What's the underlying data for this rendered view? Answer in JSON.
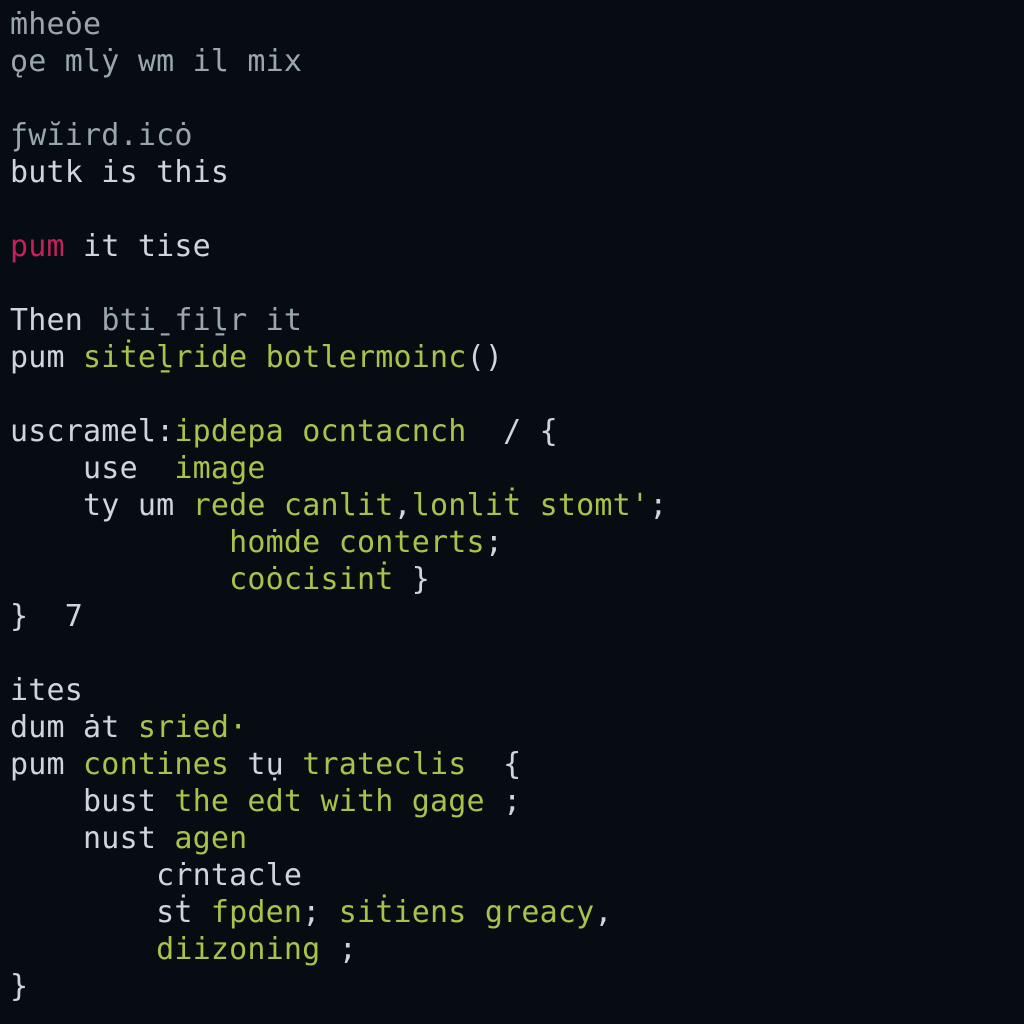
{
  "code": {
    "lines": [
      {
        "indent": 0,
        "tokens": [
          {
            "t": "ṁheȯe",
            "c": "dim"
          }
        ]
      },
      {
        "indent": 0,
        "tokens": [
          {
            "t": "ǫe mlẏ wm il mix",
            "c": "dim"
          }
        ]
      },
      {
        "indent": 0,
        "tokens": []
      },
      {
        "indent": 0,
        "tokens": [
          {
            "t": "ƒwĭird.icȯ",
            "c": "dim"
          }
        ]
      },
      {
        "indent": 0,
        "tokens": [
          {
            "t": "butk is this",
            "c": "plain"
          }
        ]
      },
      {
        "indent": 0,
        "tokens": []
      },
      {
        "indent": 0,
        "tokens": [
          {
            "t": "pum",
            "c": "kw"
          },
          {
            "t": " it tise",
            "c": "plain"
          }
        ]
      },
      {
        "indent": 0,
        "tokens": []
      },
      {
        "indent": 0,
        "tokens": [
          {
            "t": "Then ",
            "c": "plain"
          },
          {
            "t": "ḃtiˍfiḻr it",
            "c": "dim"
          }
        ]
      },
      {
        "indent": 0,
        "tokens": [
          {
            "t": "pum ",
            "c": "plain"
          },
          {
            "t": "siṫeḻride",
            "c": "fn"
          },
          {
            "t": " ",
            "c": "plain"
          },
          {
            "t": "botlermoinc",
            "c": "fn"
          },
          {
            "t": "()",
            "c": "punc"
          }
        ]
      },
      {
        "indent": 0,
        "tokens": []
      },
      {
        "indent": 0,
        "tokens": [
          {
            "t": "uscramel:",
            "c": "plain"
          },
          {
            "t": "ipdepa ocntacnch",
            "c": "fn"
          },
          {
            "t": "  / {",
            "c": "punc"
          }
        ]
      },
      {
        "indent": 1,
        "tokens": [
          {
            "t": "use  ",
            "c": "plain"
          },
          {
            "t": "image",
            "c": "fn"
          }
        ]
      },
      {
        "indent": 1,
        "tokens": [
          {
            "t": "ty um ",
            "c": "plain"
          },
          {
            "t": "rede canlit",
            "c": "fn"
          },
          {
            "t": ",",
            "c": "punc"
          },
          {
            "t": "lonliṫ stomt'",
            "c": "fn"
          },
          {
            "t": ";",
            "c": "punc"
          }
        ]
      },
      {
        "indent": 3,
        "tokens": [
          {
            "t": "hoṁde conterts",
            "c": "fn"
          },
          {
            "t": ";",
            "c": "punc"
          }
        ]
      },
      {
        "indent": 3,
        "tokens": [
          {
            "t": "coȯcisinṫ",
            "c": "fn"
          },
          {
            "t": " }",
            "c": "punc"
          }
        ]
      },
      {
        "indent": 0,
        "tokens": [
          {
            "t": "}  7",
            "c": "punc"
          }
        ]
      },
      {
        "indent": 0,
        "tokens": []
      },
      {
        "indent": 0,
        "tokens": [
          {
            "t": "ites",
            "c": "plain"
          }
        ]
      },
      {
        "indent": 0,
        "tokens": [
          {
            "t": "dum ȧt ",
            "c": "plain"
          },
          {
            "t": "sried·",
            "c": "fn"
          }
        ]
      },
      {
        "indent": 0,
        "tokens": [
          {
            "t": "pum ",
            "c": "plain"
          },
          {
            "t": "contines",
            "c": "fn"
          },
          {
            "t": " tụ ",
            "c": "plain"
          },
          {
            "t": "trateclis",
            "c": "fn"
          },
          {
            "t": "  {",
            "c": "punc"
          }
        ]
      },
      {
        "indent": 1,
        "tokens": [
          {
            "t": "bust ",
            "c": "plain"
          },
          {
            "t": "the edt with gage",
            "c": "fn"
          },
          {
            "t": " ;",
            "c": "punc"
          }
        ]
      },
      {
        "indent": 1,
        "tokens": [
          {
            "t": "nust ",
            "c": "plain"
          },
          {
            "t": "agen",
            "c": "fn"
          }
        ]
      },
      {
        "indent": 2,
        "tokens": [
          {
            "t": "cṙntacle",
            "c": "plain"
          }
        ]
      },
      {
        "indent": 2,
        "tokens": [
          {
            "t": "sṫ ",
            "c": "plain"
          },
          {
            "t": "fpden",
            "c": "fn"
          },
          {
            "t": "; ",
            "c": "punc"
          },
          {
            "t": "siṫiens greacy",
            "c": "fn"
          },
          {
            "t": ",",
            "c": "punc"
          }
        ]
      },
      {
        "indent": 2,
        "tokens": [
          {
            "t": "diizoning",
            "c": "fn"
          },
          {
            "t": " ;",
            "c": "punc"
          }
        ]
      },
      {
        "indent": 0,
        "tokens": [
          {
            "t": "}",
            "c": "punc"
          }
        ]
      }
    ],
    "indent_unit": "    "
  }
}
